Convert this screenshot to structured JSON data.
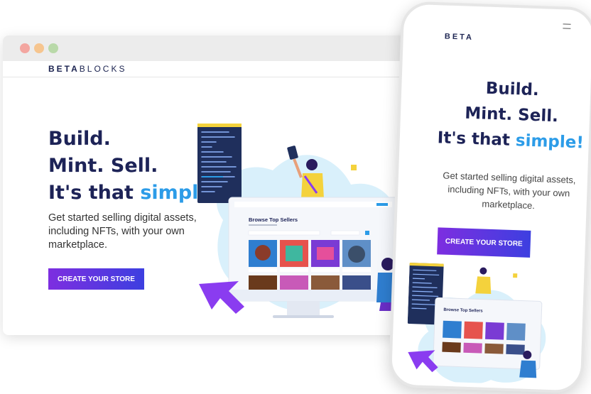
{
  "brand": {
    "logo_bold": "BETA",
    "logo_light": "BLOCKS",
    "phone_logo": "BETA"
  },
  "hero": {
    "line1": "Build.",
    "line2": "Mint. Sell.",
    "line3_prefix": "It's that ",
    "line3_accent": "simple!",
    "subtitle": "Get started selling digital assets, including NFTs, with your own marketplace.",
    "cta_label": "CREATE YOUR STORE"
  },
  "mockup_screen": {
    "title": "Browse Top Sellers"
  },
  "colors": {
    "heading": "#1d2357",
    "accent": "#2c9ce8",
    "cta_gradient_start": "#7d2ee0",
    "cta_gradient_end": "#3d3fe0",
    "blob": "#d9f0fb",
    "purple_arrow": "#8a3cf0"
  },
  "icons": [
    "menu-icon",
    "cursor-arrow-icon"
  ]
}
